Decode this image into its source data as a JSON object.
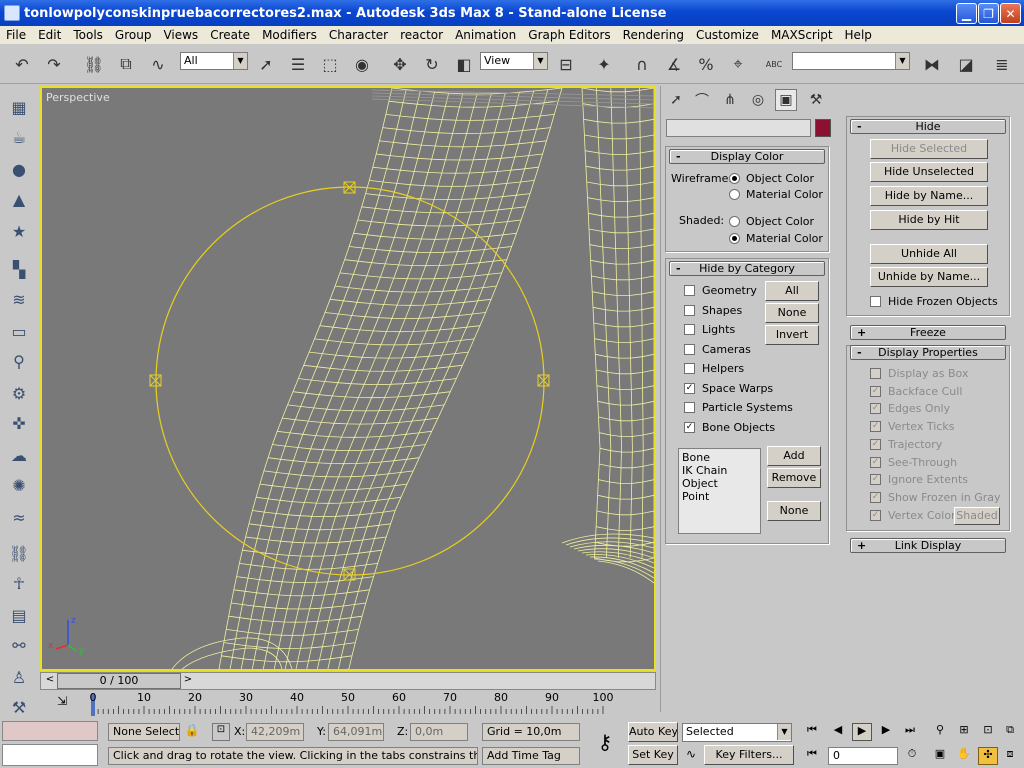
{
  "window": {
    "title": "tonlowpolyconskinpruebacorrectores2.max - Autodesk 3ds Max 8  - Stand-alone License"
  },
  "menu": [
    "File",
    "Edit",
    "Tools",
    "Group",
    "Views",
    "Create",
    "Modifiers",
    "Character",
    "reactor",
    "Animation",
    "Graph Editors",
    "Rendering",
    "Customize",
    "MAXScript",
    "Help"
  ],
  "toolbar": {
    "selection_filter": "All",
    "coord_system": "View",
    "abc_label": "ABC",
    "named_selection": ""
  },
  "viewport": {
    "label": "Perspective",
    "axis_labels": [
      "x",
      "y",
      "z"
    ],
    "bg_color": "#797979",
    "wire_color": "#f0f0a0",
    "selection_color": "#e8d020"
  },
  "timeslider": {
    "label": "0 / 100",
    "prev": "<",
    "next": ">"
  },
  "trackbar": {
    "ticks": [
      "0",
      "10",
      "20",
      "30",
      "40",
      "50",
      "60",
      "70",
      "80",
      "90",
      "100"
    ]
  },
  "command_panel": {
    "name_field": "",
    "swatch_color": "#8c1030",
    "display_color": {
      "header": "Display Color",
      "wireframe_label": "Wireframe:",
      "wire_opts": [
        "Object Color",
        "Material Color"
      ],
      "wire_selected": 0,
      "shaded_label": "Shaded:",
      "shaded_opts": [
        "Object Color",
        "Material Color"
      ],
      "shaded_selected": 1
    },
    "hide_by_category": {
      "header": "Hide by Category",
      "items": [
        {
          "label": "Geometry",
          "checked": false
        },
        {
          "label": "Shapes",
          "checked": false
        },
        {
          "label": "Lights",
          "checked": false
        },
        {
          "label": "Cameras",
          "checked": false
        },
        {
          "label": "Helpers",
          "checked": false
        },
        {
          "label": "Space Warps",
          "checked": true
        },
        {
          "label": "Particle Systems",
          "checked": false
        },
        {
          "label": "Bone Objects",
          "checked": true
        }
      ],
      "btn_all": "All",
      "btn_none": "None",
      "btn_invert": "Invert",
      "list": [
        "Bone",
        "IK Chain Object",
        "Point"
      ],
      "btn_add": "Add",
      "btn_remove": "Remove",
      "btn_none2": "None"
    }
  },
  "right_panel": {
    "hide": {
      "header": "Hide",
      "sign": "-",
      "hide_selected": "Hide Selected",
      "hide_unselected": "Hide Unselected",
      "hide_by_name": "Hide by Name...",
      "hide_by_hit": "Hide by Hit",
      "unhide_all": "Unhide All",
      "unhide_by_name": "Unhide by Name...",
      "hide_frozen": "Hide Frozen Objects"
    },
    "freeze": {
      "header": "Freeze",
      "sign": "+"
    },
    "display_properties": {
      "header": "Display Properties",
      "sign": "-",
      "items": [
        {
          "label": "Display as Box",
          "checked": false
        },
        {
          "label": "Backface Cull",
          "checked": true
        },
        {
          "label": "Edges Only",
          "checked": true
        },
        {
          "label": "Vertex Ticks",
          "checked": true
        },
        {
          "label": "Trajectory",
          "checked": true
        },
        {
          "label": "See-Through",
          "checked": true
        },
        {
          "label": "Ignore Extents",
          "checked": true
        },
        {
          "label": "Show Frozen in Gray",
          "checked": true
        },
        {
          "label": "Vertex Colors",
          "checked": true
        }
      ],
      "shaded_btn": "Shaded"
    },
    "link_display": {
      "header": "Link Display",
      "sign": "+"
    }
  },
  "status": {
    "selection": "None Selecte",
    "x_label": "X:",
    "x_value": "42,209m",
    "y_label": "Y:",
    "y_value": "64,091m",
    "z_label": "Z:",
    "z_value": "0,0m",
    "grid": "Grid = 10,0m",
    "prompt": "Click and drag to rotate the view.  Clicking in the tabs constrains the rotation",
    "add_time_tag": "Add Time Tag",
    "auto_key": "Auto Key",
    "set_key": "Set Key",
    "key_mode": "Selected",
    "key_filters": "Key Filters...",
    "frame": "0"
  }
}
